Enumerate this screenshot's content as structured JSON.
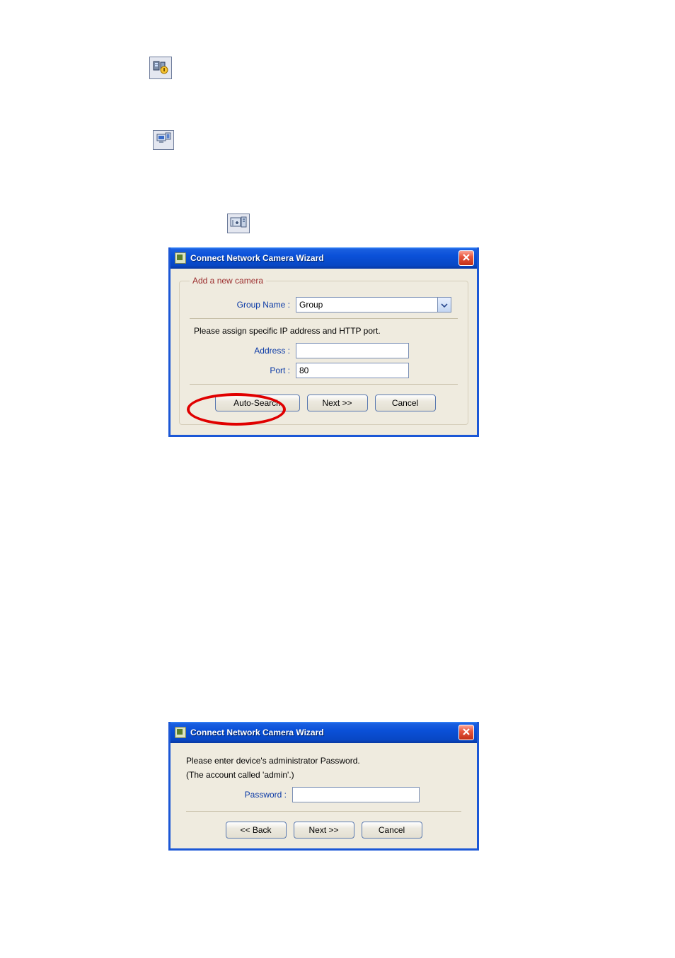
{
  "icons": {
    "main_toolbar": "configure-netcam-toolbar-icon",
    "wizard_toolbar": "netcam-wizard-toolbar-icon",
    "add_camera": "add-camera-icon"
  },
  "dialog1": {
    "title": "Connect Network Camera Wizard",
    "legend": "Add a new camera",
    "group_name_label": "Group Name :",
    "group_name_value": "Group",
    "assign_text": "Please assign specific IP address and HTTP port.",
    "address_label": "Address :",
    "address_value": "",
    "port_label": "Port :",
    "port_value": "80",
    "auto_search": "Auto-Search",
    "next": "Next >>",
    "cancel": "Cancel"
  },
  "dialog2": {
    "title": "Connect Network Camera Wizard",
    "line1": "Please enter device's administrator Password.",
    "line2": "(The account called 'admin'.)",
    "password_label": "Password :",
    "password_value": "",
    "back": "<< Back",
    "next": "Next >>",
    "cancel": "Cancel"
  }
}
